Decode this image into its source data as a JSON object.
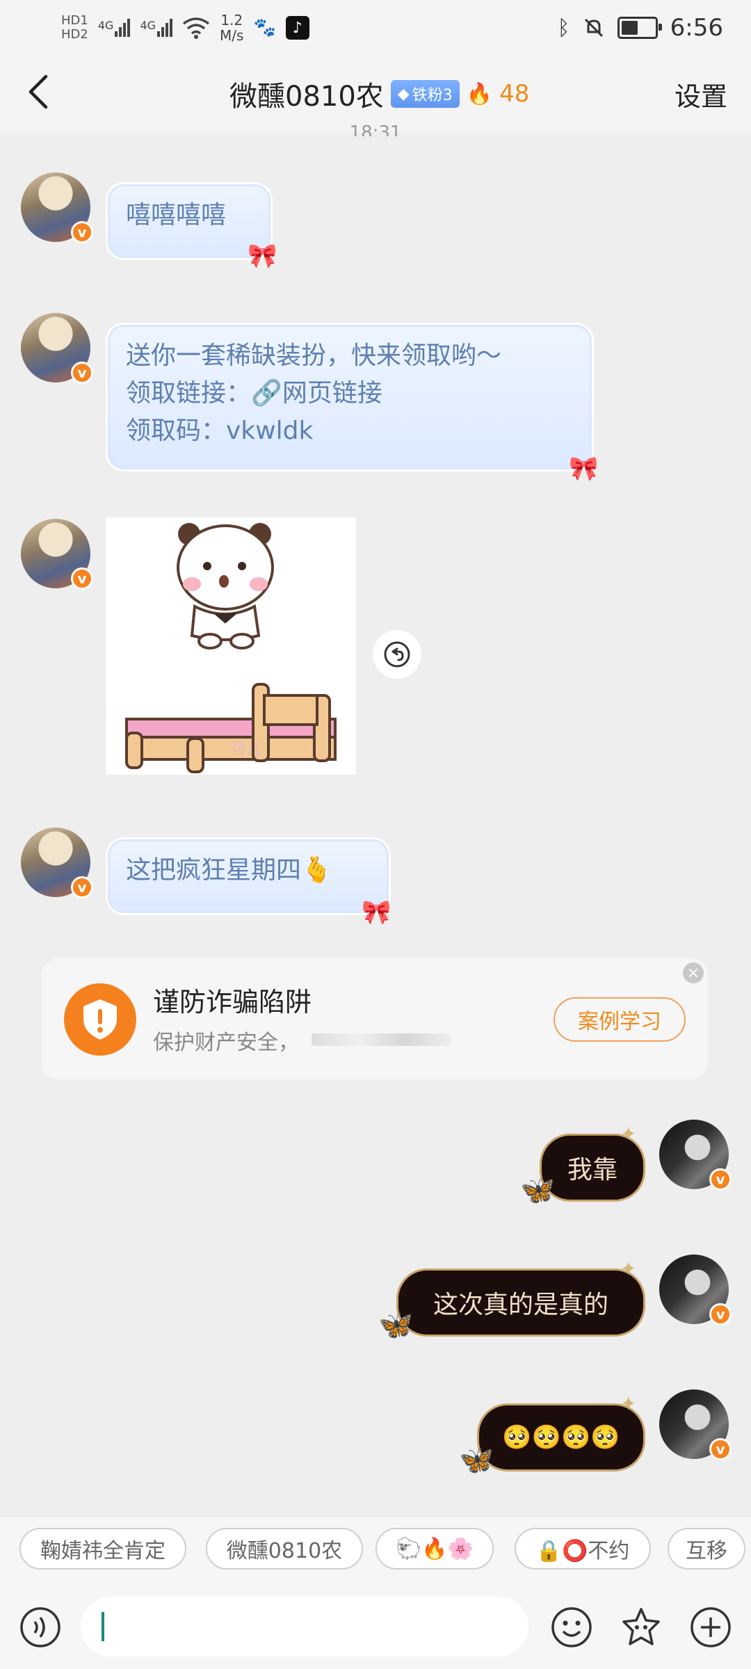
{
  "status_bar": {
    "hd1": "HD1",
    "hd2": "HD2",
    "signal1": "4G",
    "signal2": "4G",
    "net_speed_value": "1.2",
    "net_speed_unit": "M/s",
    "time": "6:56"
  },
  "header": {
    "title": "微醺0810农",
    "fan_badge": "铁粉3",
    "fire_count": "48",
    "settings": "设置"
  },
  "timestamp_partial": "18:31",
  "messages": [
    {
      "text": "嘻嘻嘻嘻"
    },
    {
      "line1": "送你一套稀缺装扮，快来领取哟～",
      "line2_prefix": "领取链接：",
      "link": "网页链接",
      "line3": "领取码：vkwldk"
    },
    {
      "sticker_watermark": "可儿"
    },
    {
      "text": "这把疯狂星期四",
      "emoji": "🫰"
    }
  ],
  "warning_card": {
    "title": "谨防诈骗陷阱",
    "subtitle": "保护财产安全，",
    "button": "案例学习"
  },
  "outgoing": [
    {
      "text": "我靠"
    },
    {
      "text": "这次真的是真的"
    },
    {
      "text": "🥺🥺🥺🥺"
    }
  ],
  "quick_chips": [
    "鞠婧祎全肯定",
    "微醺0810农",
    "🐑🔥🌸",
    "🔒⭕不约",
    "互移"
  ],
  "colors": {
    "accent_orange": "#f5831f",
    "bubble_in_text": "#5e7fb0",
    "bubble_out_bg": "#1b0d0b",
    "bubble_out_border": "#c9a36a"
  }
}
